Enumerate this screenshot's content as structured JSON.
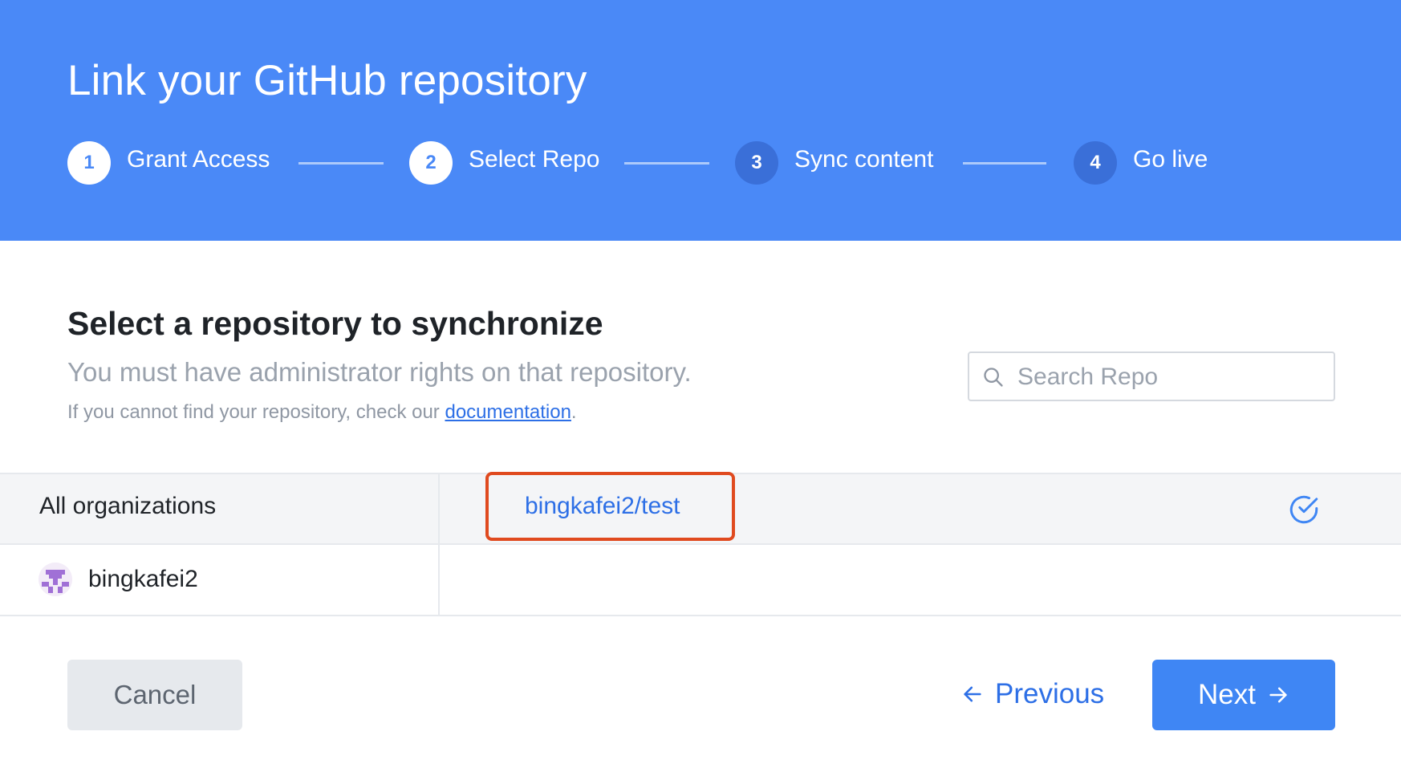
{
  "header": {
    "title": "Link your GitHub repository",
    "steps": [
      {
        "number": "1",
        "label": "Grant Access",
        "state": "active"
      },
      {
        "number": "2",
        "label": "Select Repo",
        "state": "active"
      },
      {
        "number": "3",
        "label": "Sync content",
        "state": "pending"
      },
      {
        "number": "4",
        "label": "Go live",
        "state": "pending"
      }
    ]
  },
  "main": {
    "title": "Select a repository to synchronize",
    "subtitle": "You must have administrator rights on that repository.",
    "help_prefix": "If you cannot find your repository, check our ",
    "help_link": "documentation",
    "help_suffix": ".",
    "search": {
      "placeholder": "Search Repo",
      "value": ""
    }
  },
  "organizations": [
    {
      "label": "All organizations",
      "selected": true
    },
    {
      "label": "bingkafei2",
      "selected": false,
      "avatar": "identicon"
    }
  ],
  "repositories": [
    {
      "name": "bingkafei2/test",
      "selected": true
    }
  ],
  "footer": {
    "cancel_label": "Cancel",
    "previous_label": "Previous",
    "next_label": "Next"
  },
  "colors": {
    "header_bg": "#4a89f7",
    "primary": "#3f86f4",
    "link": "#2d6fe6",
    "highlight_border": "#e04a1f"
  },
  "icons": {
    "search": "search-icon",
    "selected": "check-circle-icon",
    "previous": "arrow-left-icon",
    "next": "arrow-right-icon"
  }
}
